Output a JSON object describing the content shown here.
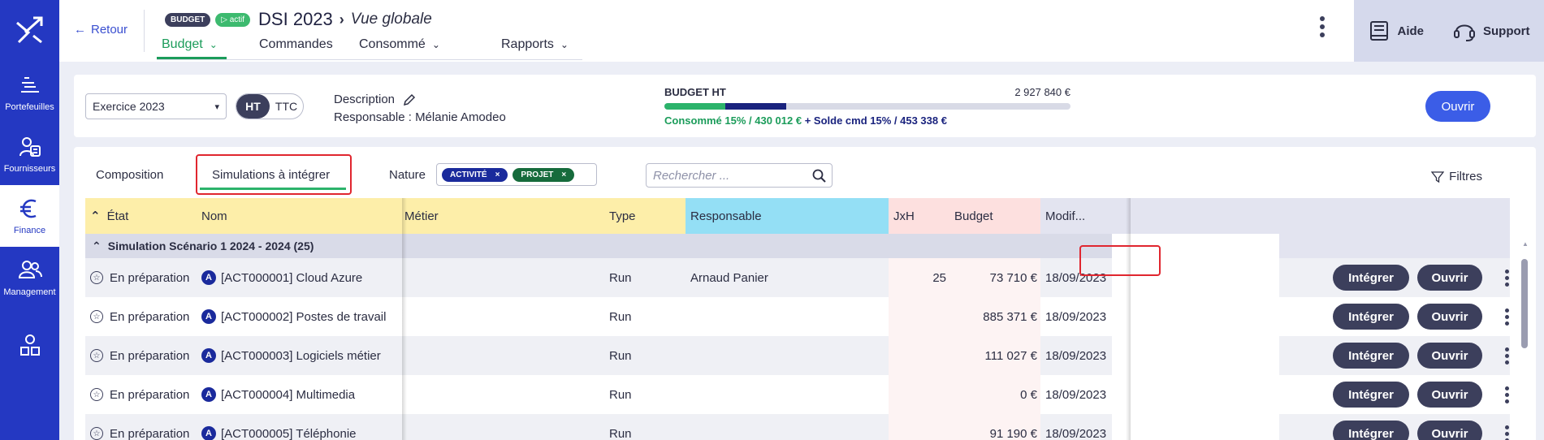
{
  "sidebar": {
    "items": [
      {
        "label": "Portefeuilles",
        "icon": "portfolio-icon"
      },
      {
        "label": "Fournisseurs",
        "icon": "supplier-icon"
      },
      {
        "label": "Finance",
        "icon": "euro-icon"
      },
      {
        "label": "Management",
        "icon": "users-icon"
      }
    ]
  },
  "header": {
    "back_label": "Retour",
    "badge_budget": "BUDGET",
    "badge_status": "actif",
    "title": "DSI 2023",
    "subtitle": "Vue globale",
    "tabs": [
      "Budget",
      "Commandes",
      "Consommé",
      "Rapports"
    ],
    "help_label": "Aide",
    "support_label": "Support"
  },
  "budget_card": {
    "exercise": "Exercice 2023",
    "toggle_ht": "HT",
    "toggle_ttc": "TTC",
    "description_label": "Description",
    "responsable": "Responsable : Mélanie Amodeo",
    "budget_label": "BUDGET HT",
    "budget_total": "2 927 840 €",
    "consumed_text": "Consommé 15% / 430 012 €",
    "order_text": "+ Solde cmd 15% / 453 338 €",
    "consumed_fraction": 0.15,
    "order_fraction": 0.15,
    "open_label": "Ouvrir"
  },
  "table_card": {
    "tabs": [
      "Composition",
      "Simulations à intégrer"
    ],
    "nature_label": "Nature",
    "chips": [
      {
        "label": "ACTIVITÉ",
        "color": "#1a2a9c"
      },
      {
        "label": "PROJET",
        "color": "#166b3c"
      }
    ],
    "search_placeholder": "Rechercher ...",
    "filters_label": "Filtres",
    "columns": [
      "État",
      "Nom",
      "Métier",
      "Type",
      "Responsable",
      "JxH",
      "Budget",
      "Modif..."
    ],
    "group_label": "Simulation Scénario 1 2024 - 2024 (25)",
    "integrate_label": "Intégrer",
    "open_label": "Ouvrir",
    "rows": [
      {
        "etat": "En préparation",
        "nom": "[ACT000001] Cloud Azure",
        "metier": "",
        "type": "Run",
        "resp": "Arnaud Panier",
        "jxh": "25",
        "budget": "73 710 €",
        "modif": "18/09/2023"
      },
      {
        "etat": "En préparation",
        "nom": "[ACT000002] Postes de travail",
        "metier": "",
        "type": "Run",
        "resp": "",
        "jxh": "",
        "budget": "885 371 €",
        "modif": "18/09/2023"
      },
      {
        "etat": "En préparation",
        "nom": "[ACT000003] Logiciels métier",
        "metier": "",
        "type": "Run",
        "resp": "",
        "jxh": "",
        "budget": "111 027 €",
        "modif": "18/09/2023"
      },
      {
        "etat": "En préparation",
        "nom": "[ACT000004] Multimedia",
        "metier": "",
        "type": "Run",
        "resp": "",
        "jxh": "",
        "budget": "0 €",
        "modif": "18/09/2023"
      },
      {
        "etat": "En préparation",
        "nom": "[ACT000005] Téléphonie",
        "metier": "",
        "type": "Run",
        "resp": "",
        "jxh": "",
        "budget": "91 190 €",
        "modif": "18/09/2023"
      }
    ]
  },
  "colors": {
    "sidebar": "#2438c2",
    "accent_green": "#1b9c5a",
    "header_yellow": "#fdeea9",
    "header_blue": "#94dff5",
    "header_pink": "#fde0df",
    "highlight_red": "#e0262f"
  }
}
